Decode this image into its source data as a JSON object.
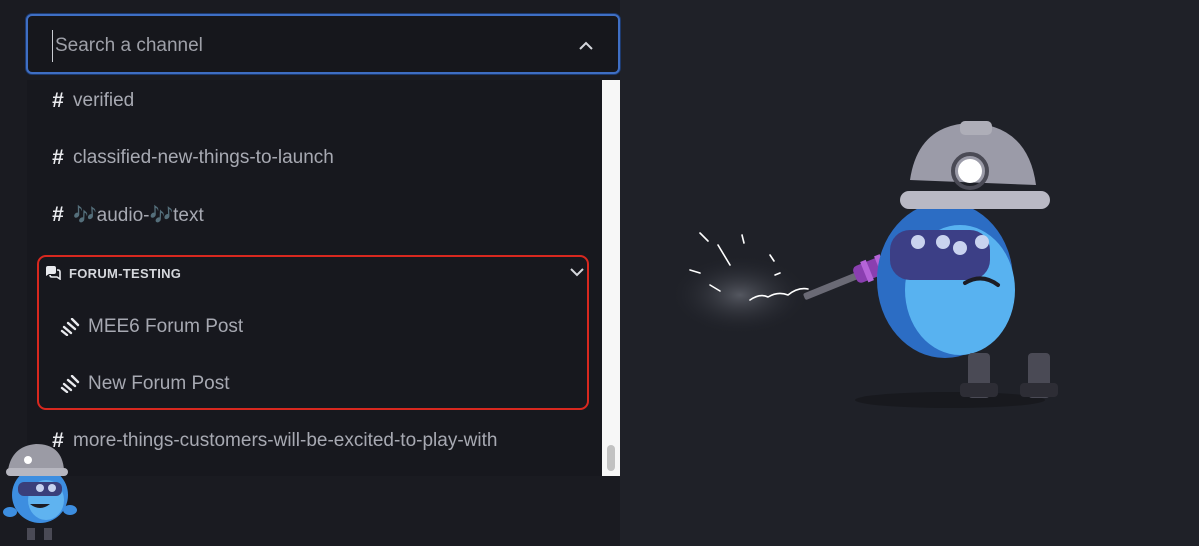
{
  "search": {
    "placeholder": "Search a channel"
  },
  "channels_top": [
    {
      "icon": "hash-icon",
      "label": "verified"
    },
    {
      "icon": "hash-icon",
      "label": "classified-new-things-to-launch"
    },
    {
      "icon": "hash-icon",
      "label": "🎶audio-🎶text"
    }
  ],
  "forum_category": {
    "icon": "forum-icon",
    "title": "FORUM-TESTING",
    "posts": [
      {
        "icon": "thread-icon",
        "label": "MEE6 Forum Post"
      },
      {
        "icon": "thread-icon",
        "label": "New Forum Post"
      }
    ]
  },
  "channels_bottom": [
    {
      "icon": "hash-icon",
      "label": "more-things-customers-will-be-excited-to-play-with"
    }
  ],
  "colors": {
    "highlight_border": "#d8281f",
    "focus_border": "#3f6fc4",
    "background": "#1f2128"
  }
}
